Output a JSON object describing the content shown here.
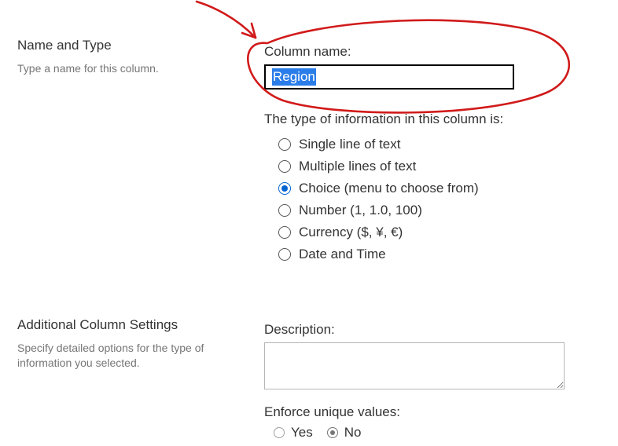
{
  "nameType": {
    "heading": "Name and Type",
    "subtext": "Type a name for this column."
  },
  "columnName": {
    "label": "Column name:",
    "value": "Region"
  },
  "typeInfo": {
    "label": "The type of information in this column is:",
    "options": [
      {
        "label": "Single line of text",
        "checked": false
      },
      {
        "label": "Multiple lines of text",
        "checked": false
      },
      {
        "label": "Choice (menu to choose from)",
        "checked": true
      },
      {
        "label": "Number (1, 1.0, 100)",
        "checked": false
      },
      {
        "label": "Currency ($, ¥, €)",
        "checked": false
      },
      {
        "label": "Date and Time",
        "checked": false
      }
    ]
  },
  "additional": {
    "heading": "Additional Column Settings",
    "subtext": "Specify detailed options for the type of information you selected."
  },
  "description": {
    "label": "Description:",
    "value": ""
  },
  "enforceUnique": {
    "label": "Enforce unique values:",
    "options": [
      {
        "label": "Yes",
        "checked": false
      },
      {
        "label": "No",
        "checked": true
      }
    ]
  },
  "annotation": {
    "color": "#d11a1a"
  }
}
